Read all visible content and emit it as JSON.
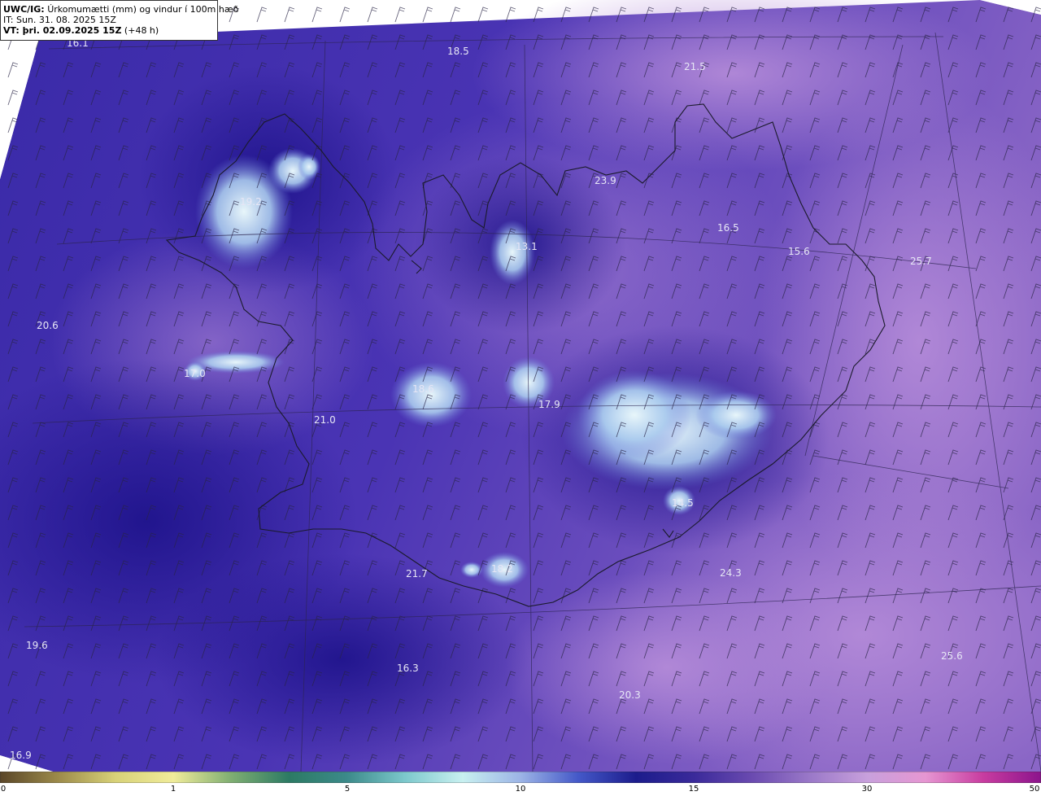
{
  "header": {
    "model_prefix": "UWC/IG:",
    "title": "Úrkomumætti (mm) og vindur í 100m hæð",
    "it_line": "IT: Sun. 31. 08. 2025 15Z",
    "vt_prefix": "VT: þri. 02.09.2025 15Z",
    "vt_suffix": " (+48 h)"
  },
  "map_values": [
    {
      "text": "16.1"
    },
    {
      "text": "18.5"
    },
    {
      "text": "21.5"
    },
    {
      "text": "23.9"
    },
    {
      "text": "19.2"
    },
    {
      "text": "13.1"
    },
    {
      "text": "16.5"
    },
    {
      "text": "15.6"
    },
    {
      "text": "25.7"
    },
    {
      "text": "20.6"
    },
    {
      "text": "17.0"
    },
    {
      "text": "18.6"
    },
    {
      "text": "17.9"
    },
    {
      "text": "21.0"
    },
    {
      "text": "14.5"
    },
    {
      "text": "21.7"
    },
    {
      "text": "18.2"
    },
    {
      "text": "24.3"
    },
    {
      "text": "19.6"
    },
    {
      "text": "25.6"
    },
    {
      "text": "16.3"
    },
    {
      "text": "20.3"
    },
    {
      "text": "16.9"
    }
  ],
  "colorbar": {
    "ticks": [
      "0",
      "1",
      "5",
      "10",
      "15",
      "30",
      "50"
    ],
    "colors": [
      "#5a4628",
      "#9c8a4a",
      "#d8d278",
      "#f0ec9a",
      "#7fae72",
      "#2c7a64",
      "#3c8a8a",
      "#7cc8cc",
      "#c8f0f0",
      "#9cb4e6",
      "#4458c8",
      "#1c1c8c",
      "#3a2a9a",
      "#6a4ab0",
      "#9a78c8",
      "#c8a0dc",
      "#e696d2",
      "#c83ca0",
      "#8c148c"
    ]
  },
  "colors": {
    "field_base": "#5a3fb8",
    "field_dark": "#2a1c9c",
    "field_light": "#a07ad0",
    "snow": "#d8ecf4",
    "coast": "#1a1a2a"
  }
}
